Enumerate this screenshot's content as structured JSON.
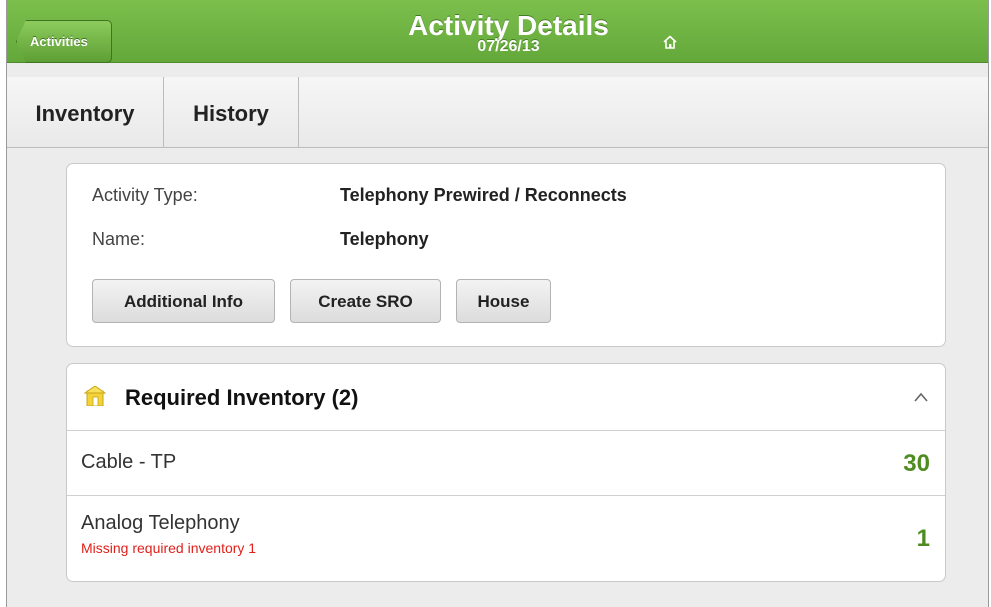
{
  "header": {
    "back_label": "Activities",
    "title": "Activity Details",
    "date": "07/26/13",
    "home_icon": "home-icon"
  },
  "tabs": [
    {
      "label": "Inventory"
    },
    {
      "label": "History"
    }
  ],
  "activity": {
    "type_label": "Activity Type:",
    "type_value": "Telephony Prewired / Reconnects",
    "name_label": "Name:",
    "name_value": "Telephony",
    "buttons": {
      "additional_info": "Additional Info",
      "create_sro": "Create SRO",
      "house": "House"
    }
  },
  "required_inventory": {
    "title": "Required Inventory (2)",
    "icon": "house-icon",
    "collapse_icon": "chevron-up-icon",
    "items": [
      {
        "name": "Cable - TP",
        "quantity": "30",
        "warning": ""
      },
      {
        "name": "Analog Telephony",
        "quantity": "1",
        "warning": "Missing required inventory 1"
      }
    ]
  },
  "colors": {
    "header_green": "#6db33f",
    "quantity_green": "#4e8c21",
    "warning_red": "#e0201a"
  }
}
